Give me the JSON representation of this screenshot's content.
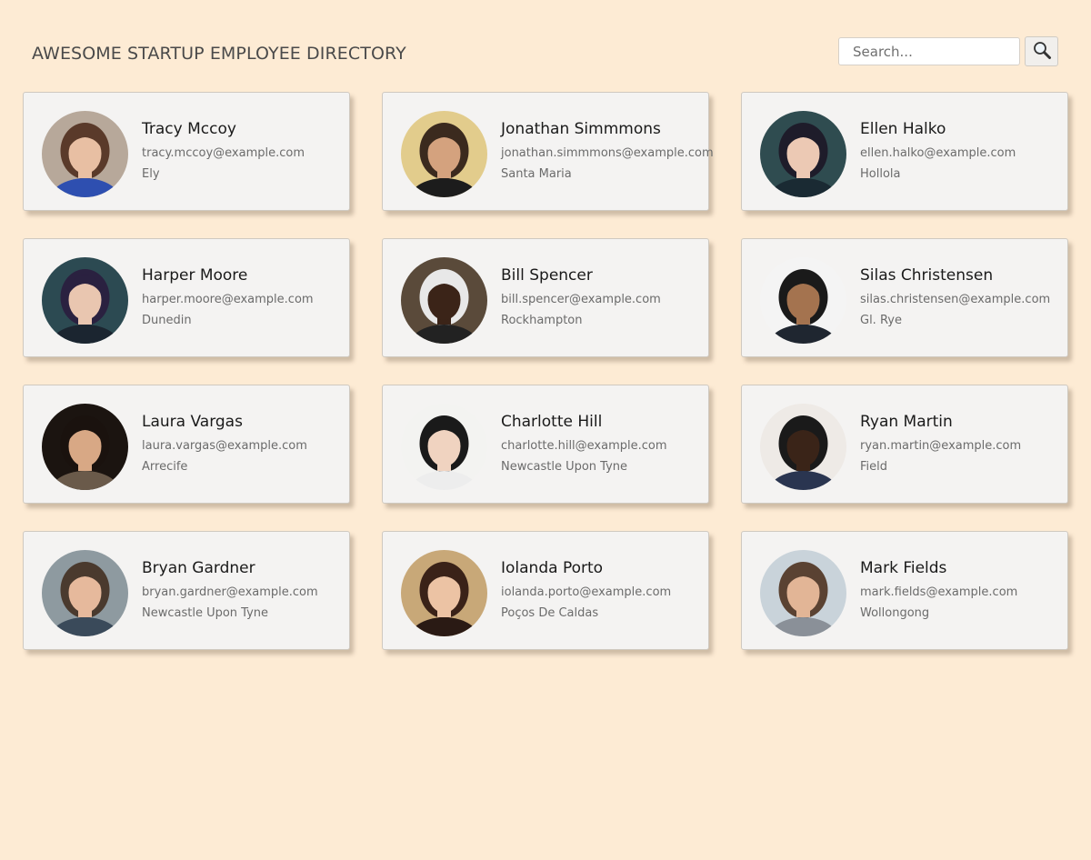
{
  "header": {
    "title": "AWESOME STARTUP EMPLOYEE DIRECTORY"
  },
  "search": {
    "placeholder": "Search...",
    "button_icon": "magnifier-icon"
  },
  "colors": {
    "page_background": "#fdebd4",
    "card_background": "#f4f3f2"
  },
  "employees": [
    {
      "name": "Tracy Mccoy",
      "email": "tracy.mccoy@example.com",
      "city": "Ely",
      "avatar": {
        "bg": "#b7a89a",
        "skin": "#e8bfa3",
        "hair": "#5a3a2a",
        "shirt": "#2e4fb0"
      }
    },
    {
      "name": "Jonathan Simmmons",
      "email": "jonathan.simmmons@example.com",
      "city": "Santa Maria",
      "avatar": {
        "bg": "#e2cc8c",
        "skin": "#d4a27e",
        "hair": "#3b2a1e",
        "shirt": "#1c1c1c"
      }
    },
    {
      "name": "Ellen Halko",
      "email": "ellen.halko@example.com",
      "city": "Hollola",
      "avatar": {
        "bg": "#2f4c50",
        "skin": "#ecc9b4",
        "hair": "#1e1c2a",
        "shirt": "#1a2a33"
      }
    },
    {
      "name": "Harper Moore",
      "email": "harper.moore@example.com",
      "city": "Dunedin",
      "avatar": {
        "bg": "#2c4a52",
        "skin": "#e9c6b0",
        "hair": "#2a2140",
        "shirt": "#1b2530"
      }
    },
    {
      "name": "Bill Spencer",
      "email": "bill.spencer@example.com",
      "city": "Rockhampton",
      "avatar": {
        "bg": "#5a4a3a",
        "skin": "#3b2418",
        "hair": "#e8e8e8",
        "shirt": "#222222"
      }
    },
    {
      "name": "Silas Christensen",
      "email": "silas.christensen@example.com",
      "city": "Gl. Rye",
      "avatar": {
        "bg": "#f4f4f4",
        "skin": "#a4734f",
        "hair": "#1a1a1a",
        "shirt": "#1f2630"
      }
    },
    {
      "name": "Laura Vargas",
      "email": "laura.vargas@example.com",
      "city": "Arrecife",
      "avatar": {
        "bg": "#1b1410",
        "skin": "#d8a885",
        "hair": "#1a120e",
        "shirt": "#6a5a4a"
      }
    },
    {
      "name": "Charlotte Hill",
      "email": "charlotte.hill@example.com",
      "city": "Newcastle Upon Tyne",
      "avatar": {
        "bg": "#f3f3f1",
        "skin": "#f0d3c0",
        "hair": "#1a1a1a",
        "shirt": "#ededed"
      }
    },
    {
      "name": "Ryan Martin",
      "email": "ryan.martin@example.com",
      "city": "Field",
      "avatar": {
        "bg": "#eeeae6",
        "skin": "#3a2418",
        "hair": "#1a1a1a",
        "shirt": "#2a3550"
      }
    },
    {
      "name": "Bryan Gardner",
      "email": "bryan.gardner@example.com",
      "city": "Newcastle Upon Tyne",
      "avatar": {
        "bg": "#8e9aa0",
        "skin": "#e6b99c",
        "hair": "#4a3a2e",
        "shirt": "#3a4a5a"
      }
    },
    {
      "name": "Iolanda Porto",
      "email": "iolanda.porto@example.com",
      "city": "Poços De Caldas",
      "avatar": {
        "bg": "#c8a878",
        "skin": "#ecc3a4",
        "hair": "#3a2218",
        "shirt": "#2a1a14"
      }
    },
    {
      "name": "Mark Fields",
      "email": "mark.fields@example.com",
      "city": "Wollongong",
      "avatar": {
        "bg": "#c9d3da",
        "skin": "#e2b596",
        "hair": "#5a4232",
        "shirt": "#8a9098"
      }
    }
  ]
}
